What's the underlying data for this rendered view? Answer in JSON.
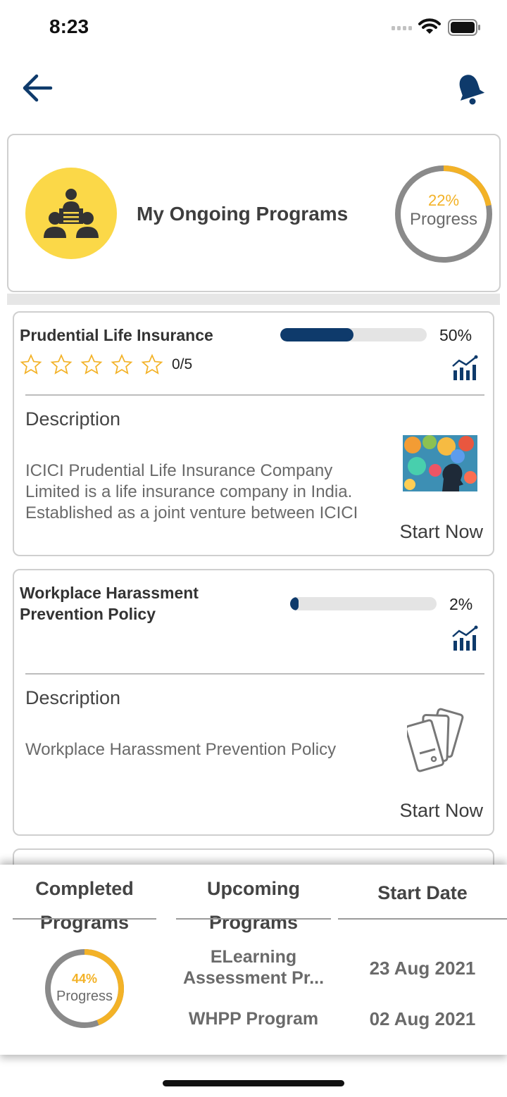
{
  "status": {
    "time": "8:23"
  },
  "colors": {
    "accent": "#0e3a6b",
    "progress": "#f3b227",
    "avatar": "#fbd848"
  },
  "header": {
    "back_icon": "arrow-left-icon",
    "bell_icon": "bell-icon"
  },
  "summary": {
    "title": "My Ongoing Programs",
    "progress_pct_label": "22%",
    "progress_label": "Progress",
    "progress_value": 0.22
  },
  "programs": [
    {
      "title": "Prudential Life Insurance",
      "progress_pct": "50%",
      "progress_value": 0.5,
      "rating": "0/5",
      "description_heading": "Description",
      "description": "ICICI Prudential Life Insurance Company Limited is a life insurance company in India. Established as a joint venture between ICICI Bank and Prudential plc.",
      "start_label": "Start Now"
    },
    {
      "title": "Workplace Harassment Prevention Policy",
      "progress_pct": "2%",
      "progress_value": 0.02,
      "description_heading": "Description",
      "description": "Workplace Harassment Prevention Policy",
      "start_label": "Start Now"
    }
  ],
  "bottom": {
    "completed_heading": "Completed Programs",
    "upcoming_heading": "Upcoming Programs",
    "start_date_heading": "Start Date",
    "completed_pct_label": "44%",
    "completed_progress_label": "Progress",
    "completed_value": 0.44,
    "upcoming": [
      {
        "name": "ELearning Assessment Pr...",
        "date": "23 Aug 2021"
      },
      {
        "name": "WHPP Program",
        "date": "02 Aug 2021"
      }
    ]
  }
}
